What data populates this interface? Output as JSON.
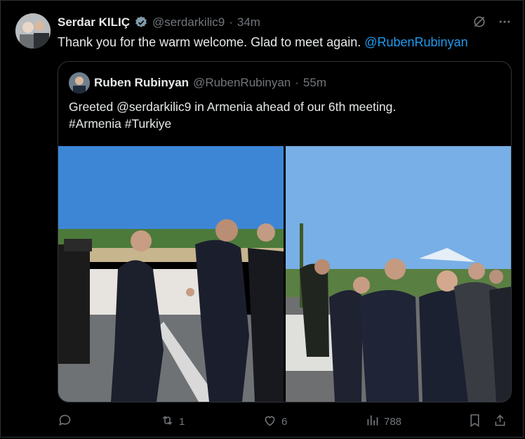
{
  "tweet": {
    "author_name": "Serdar KILIÇ",
    "handle": "@serdarkilic9",
    "separator": "·",
    "time": "34m",
    "text": "Thank you for the warm welcome. Glad to meet again.",
    "mention": "@RubenRubinyan"
  },
  "quoted": {
    "author_name": "Ruben Rubinyan",
    "handle": "@RubenRubinyan",
    "separator": "·",
    "time": "55m",
    "line1_pre": "Greeted ",
    "line1_mention": "@serdarkilic9",
    "line1_post": " in Armenia ahead of our 6th meeting.",
    "line2": "#Armenia #Turkiye"
  },
  "actions": {
    "reply_count": "",
    "retweet_count": "1",
    "like_count": "6",
    "views_count": "788"
  },
  "colors": {
    "background": "#000000",
    "border": "#2f3336",
    "text": "#e7e9ea",
    "muted": "#71767b",
    "link": "#1d9bf0"
  },
  "icons": [
    "grok-icon",
    "more-icon",
    "reply-icon",
    "retweet-icon",
    "like-icon",
    "views-icon",
    "bookmark-icon",
    "share-icon",
    "verified-badge-icon"
  ]
}
